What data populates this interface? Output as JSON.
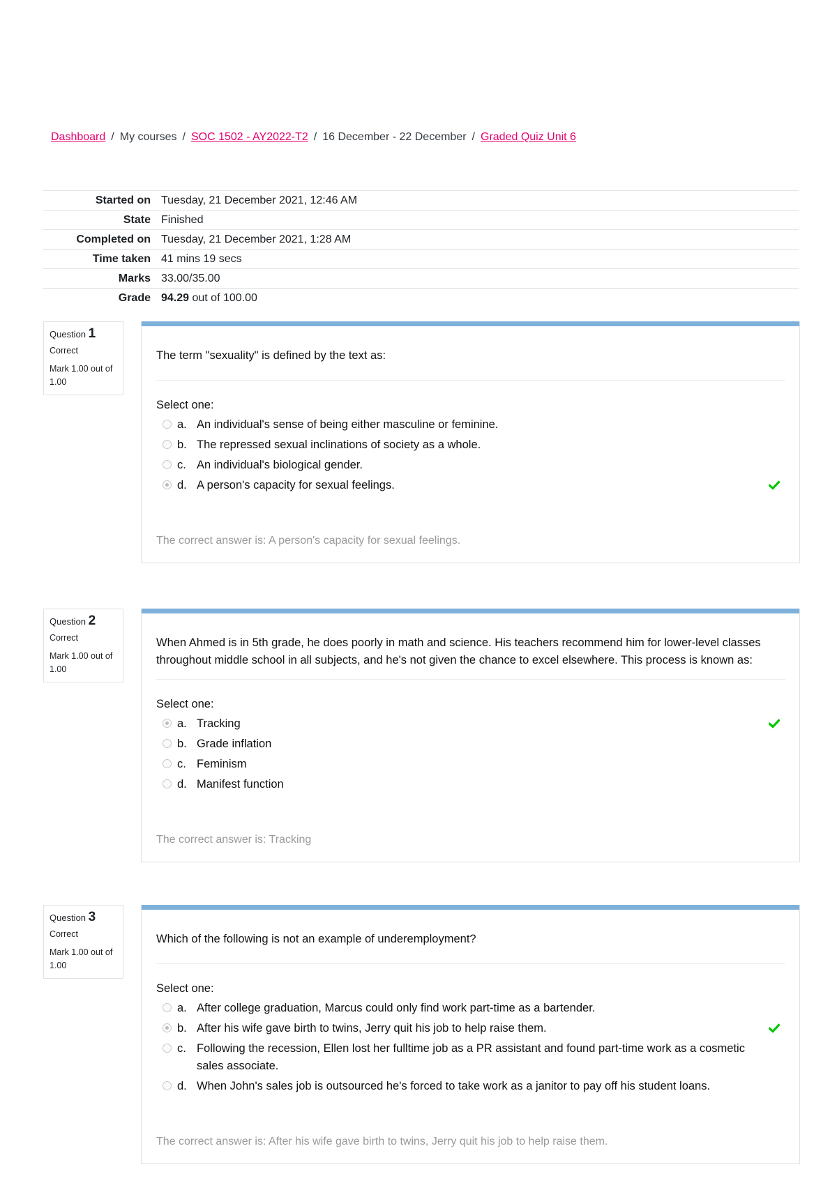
{
  "breadcrumb": [
    {
      "label": "Dashboard",
      "link": true
    },
    {
      "label": "My courses",
      "link": false
    },
    {
      "label": "SOC 1502 - AY2022-T2",
      "link": true
    },
    {
      "label": "16 December - 22 December",
      "link": false
    },
    {
      "label": "Graded Quiz Unit 6",
      "link": true
    }
  ],
  "breadcrumb_separator": "/",
  "summary": {
    "started_on": {
      "label": "Started on",
      "value": "Tuesday, 21 December 2021, 12:46 AM"
    },
    "state": {
      "label": "State",
      "value": "Finished"
    },
    "completed_on": {
      "label": "Completed on",
      "value": "Tuesday, 21 December 2021, 1:28 AM"
    },
    "time_taken": {
      "label": "Time taken",
      "value": "41 mins 19 secs"
    },
    "marks": {
      "label": "Marks",
      "value": "33.00/35.00"
    },
    "grade": {
      "label": "Grade",
      "value_bold": "94.29",
      "value_rest": " out of 100.00"
    }
  },
  "colors": {
    "link": "#e6006e",
    "question_bar": "#7eb1da",
    "correct_check": "#00c800",
    "feedback_text": "#9a9a9a"
  },
  "questions": [
    {
      "label": "Question",
      "number": "1",
      "state": "Correct",
      "grade": "Mark 1.00 out of 1.00",
      "text": "The term \"sexuality\" is defined by the text as:",
      "prompt": "Select one:",
      "answers": [
        {
          "letter": "a.",
          "text": "An individual's sense of being either masculine or feminine.",
          "selected": false,
          "correct": false
        },
        {
          "letter": "b.",
          "text": "The repressed sexual inclinations of society as a whole.",
          "selected": false,
          "correct": false
        },
        {
          "letter": "c.",
          "text": "An individual's biological gender.",
          "selected": false,
          "correct": false
        },
        {
          "letter": "d.",
          "text": "A person's capacity for sexual feelings.",
          "selected": true,
          "correct": true
        }
      ],
      "feedback": "The correct answer is: A person's capacity for sexual feelings."
    },
    {
      "label": "Question",
      "number": "2",
      "state": "Correct",
      "grade": "Mark 1.00 out of 1.00",
      "text": "When Ahmed is in 5th grade, he does poorly in math and science. His teachers recommend him for lower-level classes throughout middle school in all subjects, and he's not given the chance to excel elsewhere. This process is known as:",
      "prompt": "Select one:",
      "answers": [
        {
          "letter": "a.",
          "text": "Tracking",
          "selected": true,
          "correct": true
        },
        {
          "letter": "b.",
          "text": "Grade inflation",
          "selected": false,
          "correct": false
        },
        {
          "letter": "c.",
          "text": "Feminism",
          "selected": false,
          "correct": false
        },
        {
          "letter": "d.",
          "text": "Manifest function",
          "selected": false,
          "correct": false
        }
      ],
      "feedback": "The correct answer is: Tracking"
    },
    {
      "label": "Question",
      "number": "3",
      "state": "Correct",
      "grade": "Mark 1.00 out of 1.00",
      "text": "Which of the following is not an example of underemployment?",
      "prompt": "Select one:",
      "answers": [
        {
          "letter": "a.",
          "text": "After college graduation, Marcus could only find work part-time as a bartender.",
          "selected": false,
          "correct": false
        },
        {
          "letter": "b.",
          "text": "After his wife gave birth to twins, Jerry quit his job to help raise them.",
          "selected": true,
          "correct": true
        },
        {
          "letter": "c.",
          "text": "Following the recession, Ellen lost her fulltime job as a PR assistant and found part-time work as a cosmetic sales associate.",
          "selected": false,
          "correct": false
        },
        {
          "letter": "d.",
          "text": "When John's sales job is outsourced he's forced to take work as a janitor to pay off his student loans.",
          "selected": false,
          "correct": false
        }
      ],
      "feedback": "The correct answer is: After his wife gave birth to twins, Jerry quit his job to help raise them."
    }
  ]
}
